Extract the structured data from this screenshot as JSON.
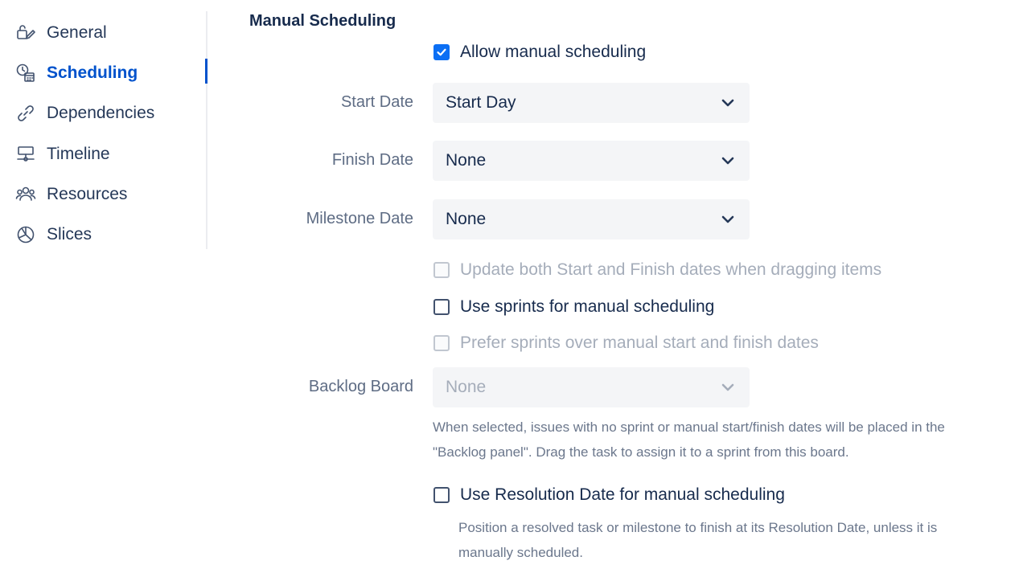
{
  "sidebar": {
    "items": [
      {
        "label": "General",
        "icon": "general-settings-icon",
        "active": false
      },
      {
        "label": "Scheduling",
        "icon": "scheduling-icon",
        "active": true
      },
      {
        "label": "Dependencies",
        "icon": "link-icon",
        "active": false
      },
      {
        "label": "Timeline",
        "icon": "timeline-icon",
        "active": false
      },
      {
        "label": "Resources",
        "icon": "people-icon",
        "active": false
      },
      {
        "label": "Slices",
        "icon": "pie-icon",
        "active": false
      }
    ]
  },
  "main": {
    "title": "Manual Scheduling",
    "allow_manual": {
      "label": "Allow manual scheduling",
      "checked": true
    },
    "start_date": {
      "label": "Start Date",
      "value": "Start Day"
    },
    "finish_date": {
      "label": "Finish Date",
      "value": "None"
    },
    "milestone_date": {
      "label": "Milestone Date",
      "value": "None"
    },
    "update_both": {
      "label": "Update both Start and Finish dates when dragging items",
      "checked": false,
      "disabled": true
    },
    "use_sprints": {
      "label": "Use sprints for manual scheduling",
      "checked": false
    },
    "prefer_sprints": {
      "label": "Prefer sprints over manual start and finish dates",
      "checked": false,
      "disabled": true
    },
    "backlog_board": {
      "label": "Backlog Board",
      "value": "None",
      "disabled": true
    },
    "backlog_help_1": "When selected, issues with no sprint or manual start/finish dates will be placed in the",
    "backlog_help_2": "\"Backlog panel\". Drag the task to assign it to a sprint from this board.",
    "use_resolution": {
      "label": "Use Resolution Date for manual scheduling",
      "checked": false
    },
    "resolution_help_1": "Position a resolved task or milestone to finish at its Resolution Date, unless it is",
    "resolution_help_2": "manually scheduled."
  },
  "colors": {
    "accent": "#0052cc",
    "checkbox_checked": "#0b6ff4"
  }
}
